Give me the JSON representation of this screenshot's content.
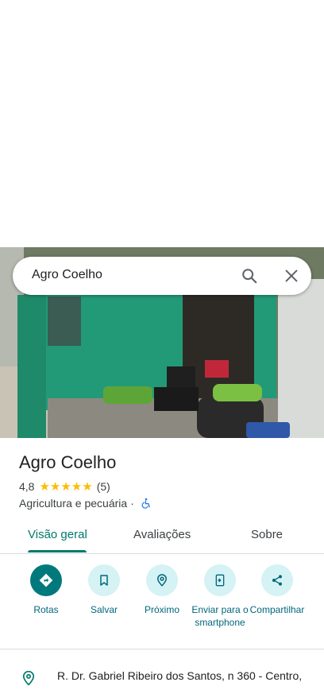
{
  "search": {
    "query": "Agro Coelho"
  },
  "place": {
    "name": "Agro Coelho",
    "rating": "4,8",
    "stars": "★★★★★",
    "review_count": "(5)",
    "category": "Agricultura e pecuária",
    "separator": "·"
  },
  "tabs": [
    {
      "label": "Visão geral"
    },
    {
      "label": "Avaliações"
    },
    {
      "label": "Sobre"
    }
  ],
  "actions": [
    {
      "label": "Rotas",
      "icon": "directions-icon"
    },
    {
      "label": "Salvar",
      "icon": "bookmark-icon"
    },
    {
      "label": "Próximo",
      "icon": "nearby-icon"
    },
    {
      "label": "Enviar para o smartphone",
      "icon": "send-to-phone-icon"
    },
    {
      "label": "Compartilhar",
      "icon": "share-icon"
    }
  ],
  "address": {
    "text": "R. Dr. Gabriel Ribeiro dos Santos, n 360 - Centro,"
  },
  "colors": {
    "accent": "#00796b",
    "action_bg": "#d5f2f5",
    "star": "#fbbc04"
  }
}
